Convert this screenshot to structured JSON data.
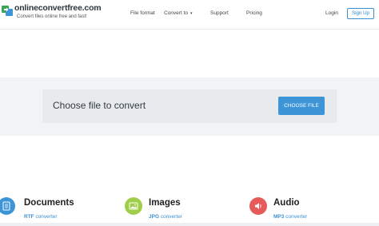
{
  "header": {
    "logo": {
      "title": "onlineconvertfree.com",
      "tagline": "Convert files online free and fast!",
      "colors": [
        "#3aa655",
        "#3d95d7"
      ]
    },
    "nav": [
      {
        "label": "File format"
      },
      {
        "label": "Convert to",
        "has_dropdown": true
      },
      {
        "label": "Support"
      },
      {
        "label": "Pricing"
      }
    ],
    "login_label": "Login",
    "signup_label": "Sign Up"
  },
  "upload": {
    "prompt": "Choose file to convert",
    "button_label": "CHOOSE FILE",
    "button_color": "#3d95d7"
  },
  "categories": [
    {
      "title": "Documents",
      "link_bold": "RTF",
      "link_rest": " converter",
      "icon": "document-icon",
      "color": "#3d95d7"
    },
    {
      "title": "Images",
      "link_bold": "JPG",
      "link_rest": " converter",
      "icon": "image-icon",
      "color": "#9fce4b"
    },
    {
      "title": "Audio",
      "link_bold": "MP3",
      "link_rest": " converter",
      "icon": "audio-icon",
      "color": "#e65a5a"
    }
  ]
}
